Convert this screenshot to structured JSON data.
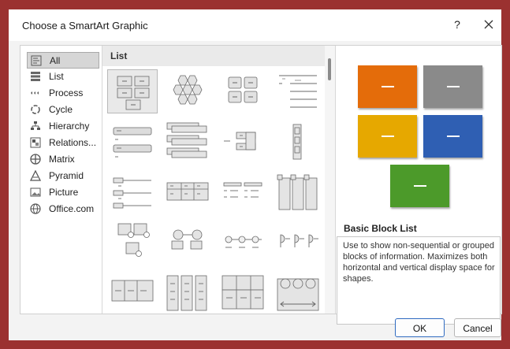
{
  "dialog": {
    "title": "Choose a SmartArt Graphic",
    "help_label": "?",
    "close_icon": "close-icon"
  },
  "categories": [
    {
      "label": "All",
      "icon": "all-icon",
      "selected": true
    },
    {
      "label": "List",
      "icon": "list-icon"
    },
    {
      "label": "Process",
      "icon": "process-icon"
    },
    {
      "label": "Cycle",
      "icon": "cycle-icon"
    },
    {
      "label": "Hierarchy",
      "icon": "hierarchy-icon"
    },
    {
      "label": "Relations...",
      "icon": "relationship-icon"
    },
    {
      "label": "Matrix",
      "icon": "matrix-icon"
    },
    {
      "label": "Pyramid",
      "icon": "pyramid-icon"
    },
    {
      "label": "Picture",
      "icon": "picture-icon"
    },
    {
      "label": "Office.com",
      "icon": "globe-icon"
    }
  ],
  "gallery": {
    "header": "List",
    "selected_index": 0
  },
  "preview": {
    "name": "Basic Block List",
    "description": "Use to show non-sequential or grouped blocks of information. Maximizes both horizontal and vertical display space for shapes.",
    "colors": {
      "orange": "#e46c0a",
      "gray": "#8a8a8a",
      "gold": "#e6a800",
      "blue": "#2f5fb3",
      "green": "#4c9a2a"
    }
  },
  "buttons": {
    "ok": "OK",
    "cancel": "Cancel"
  }
}
